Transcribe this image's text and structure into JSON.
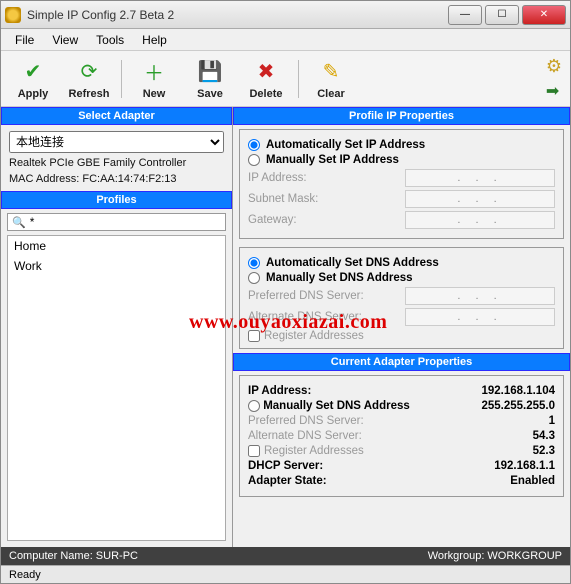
{
  "window": {
    "title": "Simple IP Config 2.7 Beta 2"
  },
  "menu": {
    "file": "File",
    "view": "View",
    "tools": "Tools",
    "help": "Help"
  },
  "toolbar": {
    "apply": "Apply",
    "refresh": "Refresh",
    "new": "New",
    "save": "Save",
    "delete": "Delete",
    "clear": "Clear"
  },
  "left": {
    "selectAdapterHdr": "Select Adapter",
    "adapter": "本地连接",
    "adapterDesc": "Realtek PCIe GBE Family Controller",
    "macLabel": "MAC Address: FC:AA:14:74:F2:13",
    "profilesHdr": "Profiles",
    "searchValue": "*",
    "profiles": [
      "Home",
      "Work"
    ]
  },
  "ipProps": {
    "hdr": "Profile IP Properties",
    "autoIP": "Automatically Set IP Address",
    "manualIP": "Manually Set IP Address",
    "ipLabel": "IP Address:",
    "subnetLabel": "Subnet Mask:",
    "gwLabel": "Gateway:",
    "autoDNS": "Automatically Set DNS Address",
    "manualDNS": "Manually Set DNS Address",
    "prefDNS": "Preferred DNS Server:",
    "altDNS": "Alternate DNS Server:",
    "register": "Register Addresses"
  },
  "current": {
    "hdr": "Current Adapter Properties",
    "ipLabel": "IP Address:",
    "ipVal": "192.168.1.104",
    "subnetVal": "255.255.255.0",
    "gwValTail": "1",
    "manualDNSLine": "Manually Set DNS Address",
    "prefDNS": "Preferred DNS Server:",
    "prefDNSTail": "54.3",
    "altDNS": "Alternate DNS Server:",
    "altDNSTail": "52.3",
    "register": "Register Addresses",
    "dhcpLabel": "DHCP Server:",
    "dhcpVal": "192.168.1.1",
    "stateLabel": "Adapter State:",
    "stateVal": "Enabled"
  },
  "status": {
    "computer": "Computer Name: SUR-PC",
    "workgroup": "Workgroup: WORKGROUP",
    "ready": "Ready"
  },
  "watermark": "www.ouyaoxiazai.com"
}
